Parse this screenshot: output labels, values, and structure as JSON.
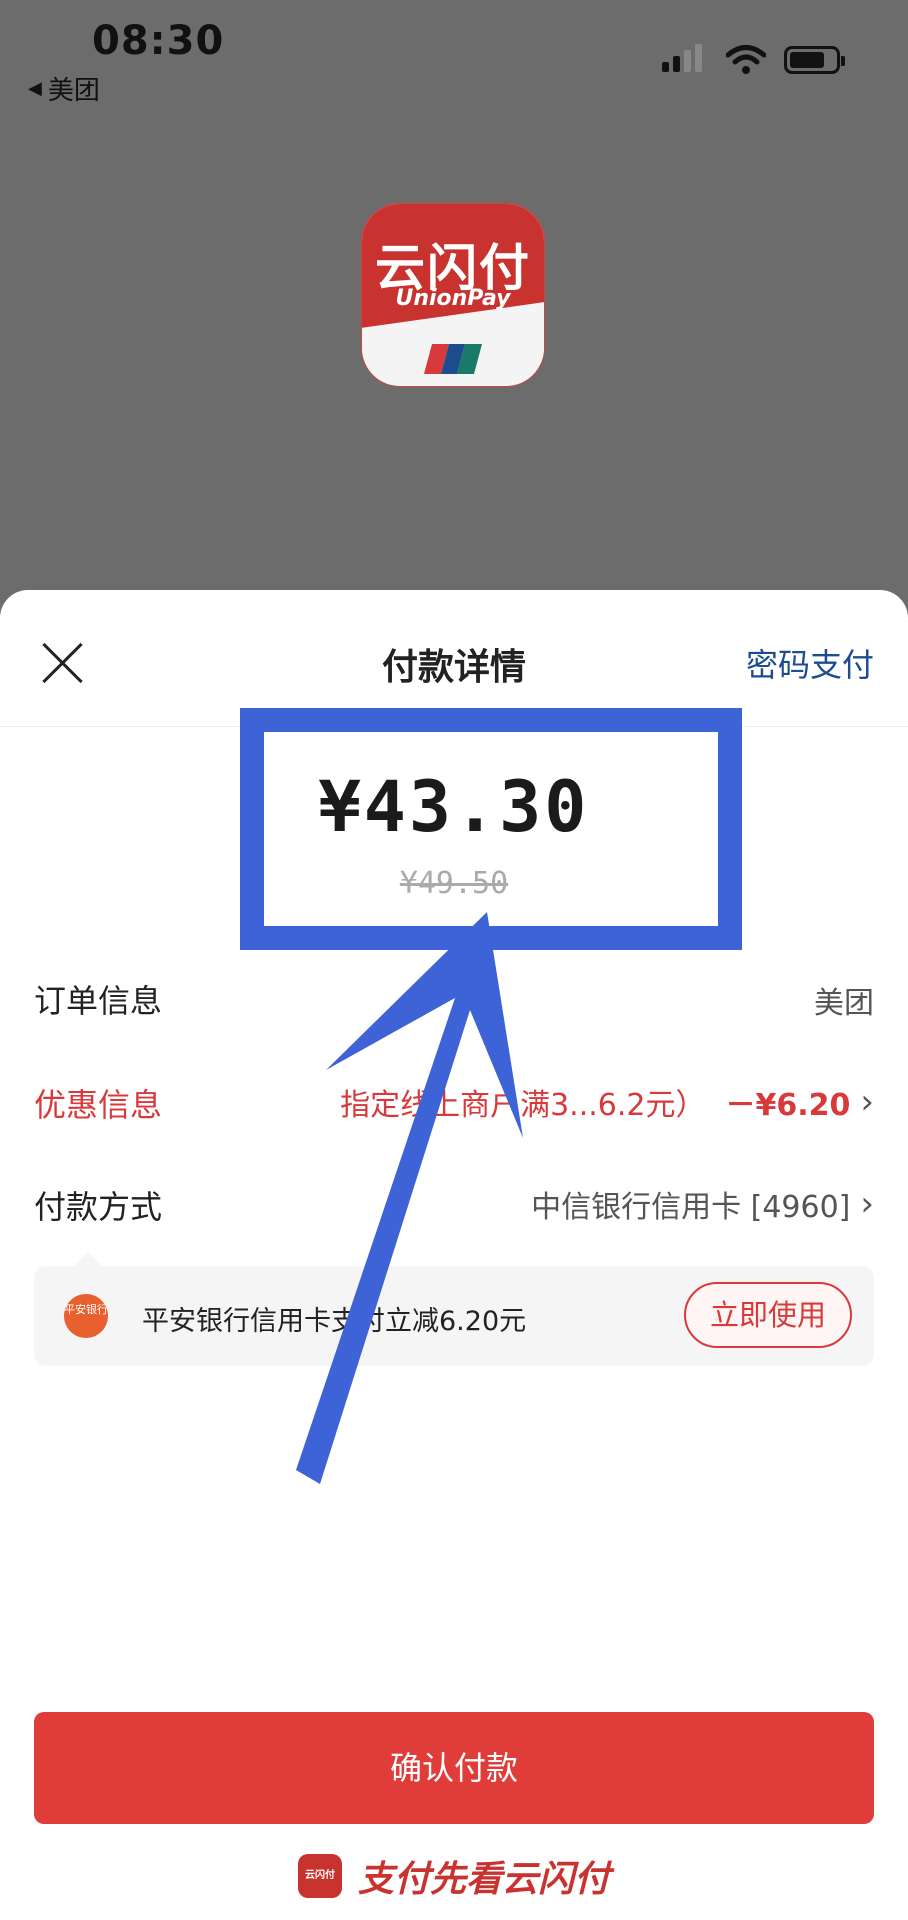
{
  "status_bar": {
    "time": "08:30",
    "back_app": "美团"
  },
  "app_logo": {
    "name_cn": "云闪付",
    "name_en": "UnionPay"
  },
  "sheet": {
    "title": "付款详情",
    "password_pay": "密码支付",
    "amount": "¥43.30",
    "original_amount": "¥49.50",
    "rows": {
      "order_label": "订单信息",
      "order_value": "美团",
      "discount_label": "优惠信息",
      "discount_desc": "指定线上商户满3...6.2元）",
      "discount_amount": "－¥6.20",
      "payment_label": "付款方式",
      "payment_value": "中信银行信用卡 [4960]"
    },
    "promo": {
      "bank_logo_text": "平安银行",
      "text": "平安银行信用卡支付立减6.20元",
      "use_button": "立即使用"
    },
    "confirm_button": "确认付款",
    "footer_slogan": "支付先看云闪付",
    "footer_logo_text": "云闪付"
  },
  "colors": {
    "accent_red": "#e03d3a",
    "link_blue": "#1d4d8f",
    "annotation_blue": "#3d63d6"
  }
}
